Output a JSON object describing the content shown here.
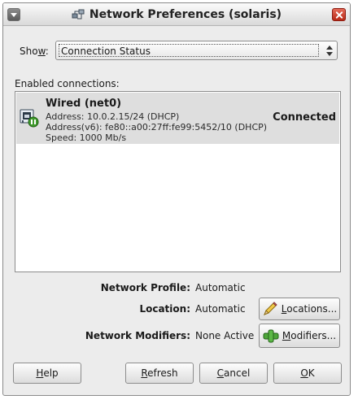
{
  "window": {
    "title": "Network Preferences (solaris)",
    "title_icon": "network-preferences-icon"
  },
  "show": {
    "label_prefix": "Sho",
    "label_mnemonic": "w",
    "label_suffix": ":",
    "selected": "Connection Status"
  },
  "connections": {
    "header": "Enabled connections:",
    "items": [
      {
        "name": "Wired (net0)",
        "address": "Address: 10.0.2.15/24 (DHCP)",
        "address_v6": "Address(v6): fe80::a00:27ff:fe99:5452/10 (DHCP)",
        "speed": "Speed: 1000 Mb/s",
        "status": "Connected",
        "icon": "wired-connection-icon"
      }
    ]
  },
  "profile": {
    "network_profile_label": "Network Profile:",
    "network_profile_value": "Automatic",
    "location_label": "Location:",
    "location_value": "Automatic",
    "locations_button_mnemonic": "L",
    "locations_button_rest": "ocations...",
    "modifiers_label": "Network Modifiers:",
    "modifiers_value": "None Active",
    "modifiers_button_mnemonic": "M",
    "modifiers_button_rest": "odifiers..."
  },
  "footer": {
    "help_mnemonic": "H",
    "help_rest": "elp",
    "refresh_mnemonic": "R",
    "refresh_rest": "efresh",
    "cancel_mnemonic": "C",
    "cancel_rest": "ancel",
    "ok_mnemonic": "O",
    "ok_rest": "K"
  },
  "colors": {
    "window_bg": "#ececec",
    "selected_row_bg": "#dedede",
    "close_button": "#c8341f"
  }
}
